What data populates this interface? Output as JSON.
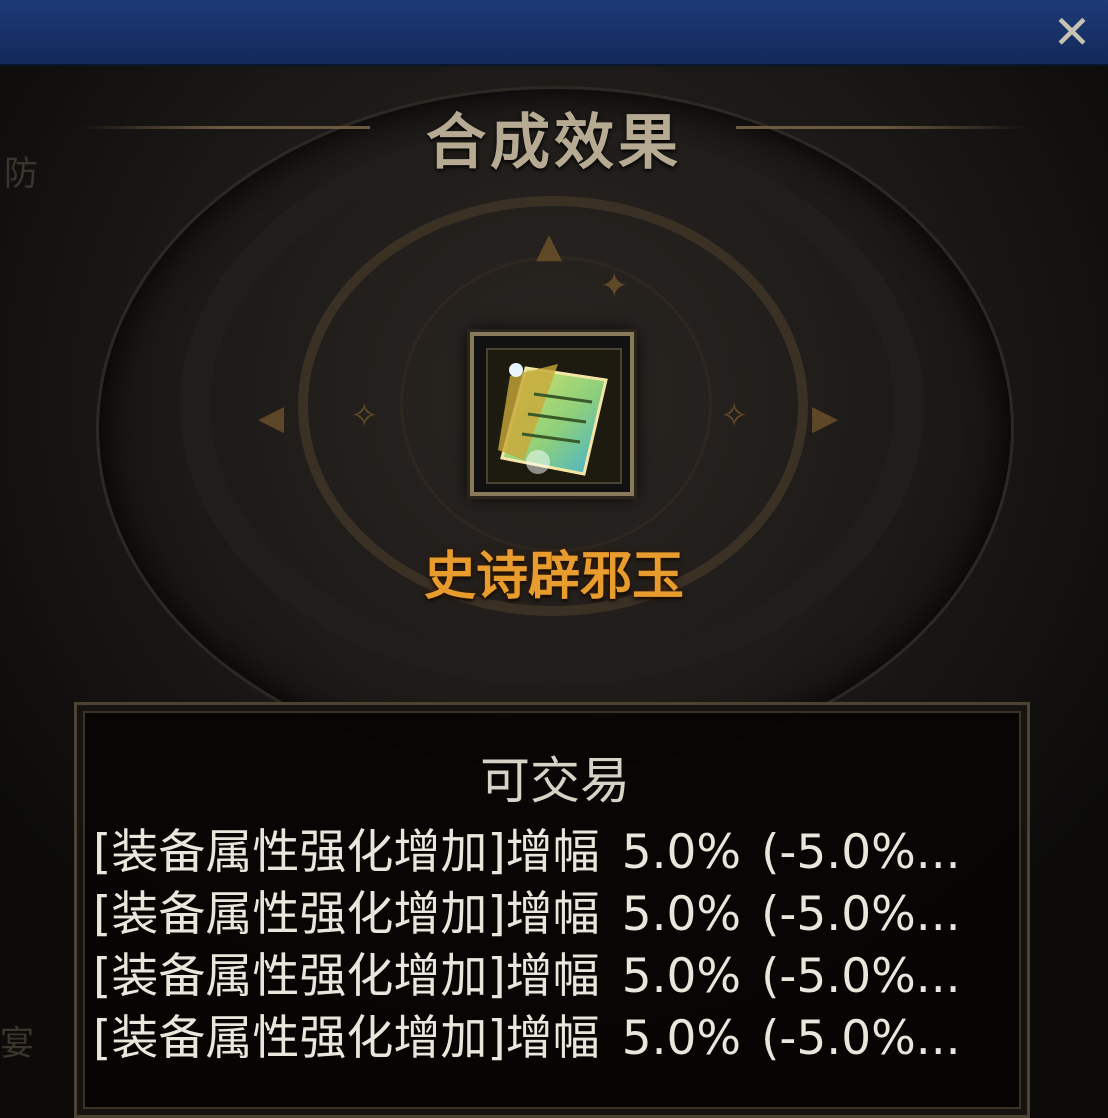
{
  "window": {
    "close_icon": "close-icon"
  },
  "panel": {
    "title": "合成效果",
    "side_chars": {
      "left_top": "防",
      "left_bottom": "宴"
    }
  },
  "item": {
    "icon": "jade-card-icon",
    "name": "史诗辟邪玉",
    "name_color": "#e79c2d"
  },
  "info": {
    "tradable": "可交易",
    "stats": [
      {
        "label": "[装备属性强化增加]增幅",
        "value": "5.0%",
        "delta": "(-5.0%..."
      },
      {
        "label": "[装备属性强化增加]增幅",
        "value": "5.0%",
        "delta": "(-5.0%..."
      },
      {
        "label": "[装备属性强化增加]增幅",
        "value": "5.0%",
        "delta": "(-5.0%..."
      },
      {
        "label": "[装备属性强化增加]增幅",
        "value": "5.0%",
        "delta": "(-5.0%..."
      }
    ]
  },
  "colors": {
    "titlebar": "#1d3a78",
    "accent_gold": "#e79c2d",
    "text": "#e9e6dc"
  }
}
